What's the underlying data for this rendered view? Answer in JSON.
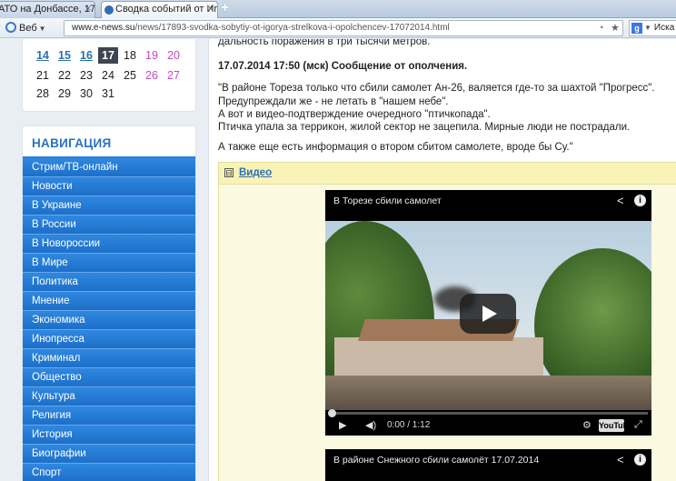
{
  "browser": {
    "tabs": [
      {
        "label": "АТО на Донбассе, 17 ...",
        "active": false
      },
      {
        "label": "Сводка событий от Иг...",
        "active": true
      }
    ],
    "new_tab_glyph": "+",
    "close_glyph": "×",
    "web_button": "Веб",
    "url_host": "www.e-news.su",
    "url_path": "/news/17893-svodka-sobytiy-ot-igorya-strelkova-i-opolchencev-17072014.html",
    "search_text": "Иска",
    "search_engine_glyph": "g"
  },
  "calendar": {
    "rows": [
      [
        {
          "d": "14",
          "kind": "link"
        },
        {
          "d": "15",
          "kind": "link"
        },
        {
          "d": "16",
          "kind": "link"
        },
        {
          "d": "17",
          "kind": "today"
        },
        {
          "d": "18",
          "kind": "plain"
        },
        {
          "d": "19",
          "kind": "weekend"
        },
        {
          "d": "20",
          "kind": "weekend"
        }
      ],
      [
        {
          "d": "21",
          "kind": "plain"
        },
        {
          "d": "22",
          "kind": "plain"
        },
        {
          "d": "23",
          "kind": "plain"
        },
        {
          "d": "24",
          "kind": "plain"
        },
        {
          "d": "25",
          "kind": "plain"
        },
        {
          "d": "26",
          "kind": "weekend"
        },
        {
          "d": "27",
          "kind": "weekend"
        }
      ],
      [
        {
          "d": "28",
          "kind": "plain"
        },
        {
          "d": "29",
          "kind": "plain"
        },
        {
          "d": "30",
          "kind": "plain"
        },
        {
          "d": "31",
          "kind": "plain"
        }
      ]
    ]
  },
  "navigation": {
    "title": "НАВИГАЦИЯ",
    "items": [
      "Стрим/ТВ-онлайн",
      "Новости",
      "В Украине",
      "В России",
      "В Новороссии",
      "В Мире",
      "Политика",
      "Мнение",
      "Экономика",
      "Инопресса",
      "Криминал",
      "Общество",
      "Культура",
      "Религия",
      "История",
      "Биографии",
      "Спорт"
    ]
  },
  "article": {
    "top_line": "дальность поражения в три тысячи метров.",
    "heading": "17.07.2014 17:50 (мск) Сообщение от ополчения.",
    "quote_lines": [
      "\"В районе Тореза только что сбили самолет Ан-26, валяется где-то за шахтой \"Прогресс\".",
      "Предупреждали же - не летать в \"нашем небе\".",
      "А вот и видео-подтверждение очередного \"птичкопада\".",
      "Птичка упала за террикон, жилой сектор не зацепила. Мирные люди не пострадали."
    ],
    "extra_line": "А также еще есть информация о втором сбитом самолете, вроде бы Су.\""
  },
  "video_section": {
    "toggle_glyph": "⊟",
    "label": "Видео",
    "player1": {
      "title": "В Торезе сбили самолет",
      "time": "0:00 / 1:12",
      "progress": 0,
      "logo": "YouTube"
    },
    "player2": {
      "title": "В районе Снежного  сбили  самолёт 17.07.2014"
    }
  }
}
